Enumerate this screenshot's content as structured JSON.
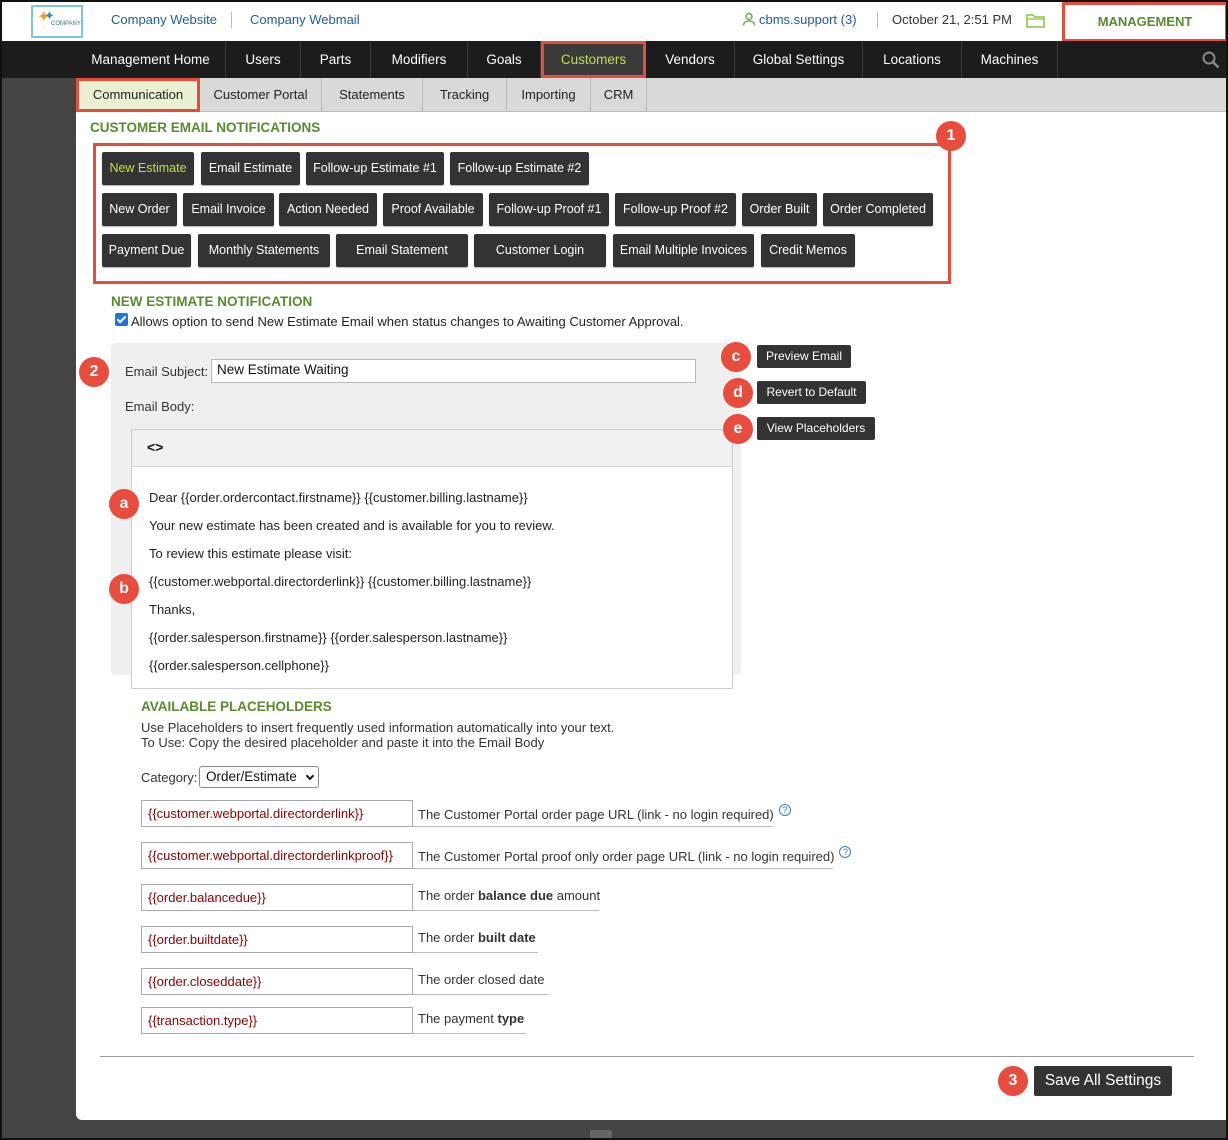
{
  "topbar": {
    "logo_text": "COMPANY",
    "links": [
      "Company Website",
      "Company Webmail"
    ],
    "user": "cbms.support (3)",
    "datetime": "October 21, 2:51 PM",
    "management": "MANAGEMENT"
  },
  "mainnav": [
    "Management Home",
    "Users",
    "Parts",
    "Modifiers",
    "Goals",
    "Customers",
    "Vendors",
    "Global Settings",
    "Locations",
    "Machines"
  ],
  "subnav": [
    "Communication",
    "Customer Portal",
    "Statements",
    "Tracking",
    "Importing",
    "CRM"
  ],
  "section_title": "CUSTOMER EMAIL NOTIFICATIONS",
  "notification_buttons": [
    [
      "New Estimate",
      "Email Estimate",
      "Follow-up Estimate #1",
      "Follow-up Estimate #2"
    ],
    [
      "New Order",
      "Email Invoice",
      "Action Needed",
      "Proof Available",
      "Follow-up Proof #1",
      "Follow-up Proof #2",
      "Order Built",
      "Order Completed"
    ],
    [
      "Payment Due",
      "Monthly Statements",
      "Email Statement",
      "Customer Login",
      "Email Multiple Invoices",
      "Credit Memos"
    ]
  ],
  "notification": {
    "title": "NEW ESTIMATE NOTIFICATION",
    "checkbox_label": "Allows option to send New Estimate Email when status changes to Awaiting Customer Approval.",
    "checked": true,
    "subject_label": "Email Subject:",
    "subject_value": "New Estimate Waiting",
    "body_label": "Email Body:",
    "toolbar_icon": "<>",
    "body_lines": [
      "Dear {{order.ordercontact.firstname}} {{customer.billing.lastname}}",
      "Your new estimate has been created and is available for you to review.",
      "To review this estimate please visit:",
      "{{customer.webportal.directorderlink}} {{customer.billing.lastname}}",
      "Thanks,",
      "{{order.salesperson.firstname}} {{order.salesperson.lastname}}",
      "{{order.salesperson.cellphone}}"
    ],
    "preview_btn": "Preview Email",
    "revert_btn": "Revert to Default",
    "view_ph_btn": "View Placeholders"
  },
  "placeholders": {
    "title": "AVAILABLE PLACEHOLDERS",
    "help_line1": "Use Placeholders to insert frequently used information automatically into your text.",
    "help_line2": "To Use: Copy the desired placeholder and paste it into the Email Body",
    "category_label": "Category:",
    "category_value": "Order/Estimate",
    "items": [
      {
        "code": "{{customer.webportal.directorderlink}}",
        "pre": "The Customer Portal order page URL (link - no login required)",
        "bold": "",
        "post": "",
        "help": true
      },
      {
        "code": "{{customer.webportal.directorderlinkproof}}",
        "pre": "The Customer Portal proof only order page URL (link - no login required)",
        "bold": "",
        "post": "",
        "help": true
      },
      {
        "code": "{{order.balancedue}}",
        "pre": "The order ",
        "bold": "balance due",
        "post": " amount",
        "help": false
      },
      {
        "code": "{{order.builtdate}}",
        "pre": "The order ",
        "bold": "built date",
        "post": "",
        "help": false
      },
      {
        "code": "{{order.closeddate}}",
        "pre": "The order closed date",
        "bold": "",
        "post": "",
        "help": false
      },
      {
        "code": "{{transaction.type}}",
        "pre": "The payment ",
        "bold": "type",
        "post": "",
        "help": false
      }
    ]
  },
  "save_btn": "Save All Settings",
  "badges": {
    "b1": "1",
    "b2": "2",
    "b3": "3",
    "ba": "a",
    "bb": "b",
    "bc": "c",
    "bd": "d",
    "be": "e"
  },
  "colors": {
    "accent_green": "#5a8a2e",
    "highlight_red": "#e74c3c",
    "nav_dark": "#1c1c1c",
    "button_dark": "#333333"
  }
}
